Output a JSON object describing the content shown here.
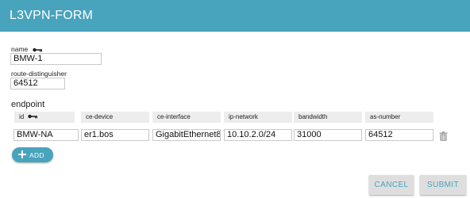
{
  "header": {
    "title": "L3VPN-FORM"
  },
  "form": {
    "name_label": "name",
    "name_value": "BMW-1",
    "rd_label": "route-distinguisher",
    "rd_value": "64512"
  },
  "endpoint": {
    "section_label": "endpoint",
    "columns": [
      "id",
      "ce-device",
      "ce-interface",
      "ip-network",
      "bandwidth",
      "as-number"
    ],
    "rows": [
      [
        "BMW-NA",
        "er1.bos",
        "GigabitEthernet8",
        "10.10.2.0/24",
        "31000",
        "64512"
      ]
    ],
    "add_label": "ADD"
  },
  "actions": {
    "cancel_label": "CANCEL",
    "submit_label": "SUBMIT"
  },
  "colors": {
    "accent": "#48a3bd",
    "button_bg": "#dedede",
    "header_cell_bg": "#ededed"
  },
  "icons": [
    "key-icon",
    "trash-icon",
    "plus-icon"
  ]
}
